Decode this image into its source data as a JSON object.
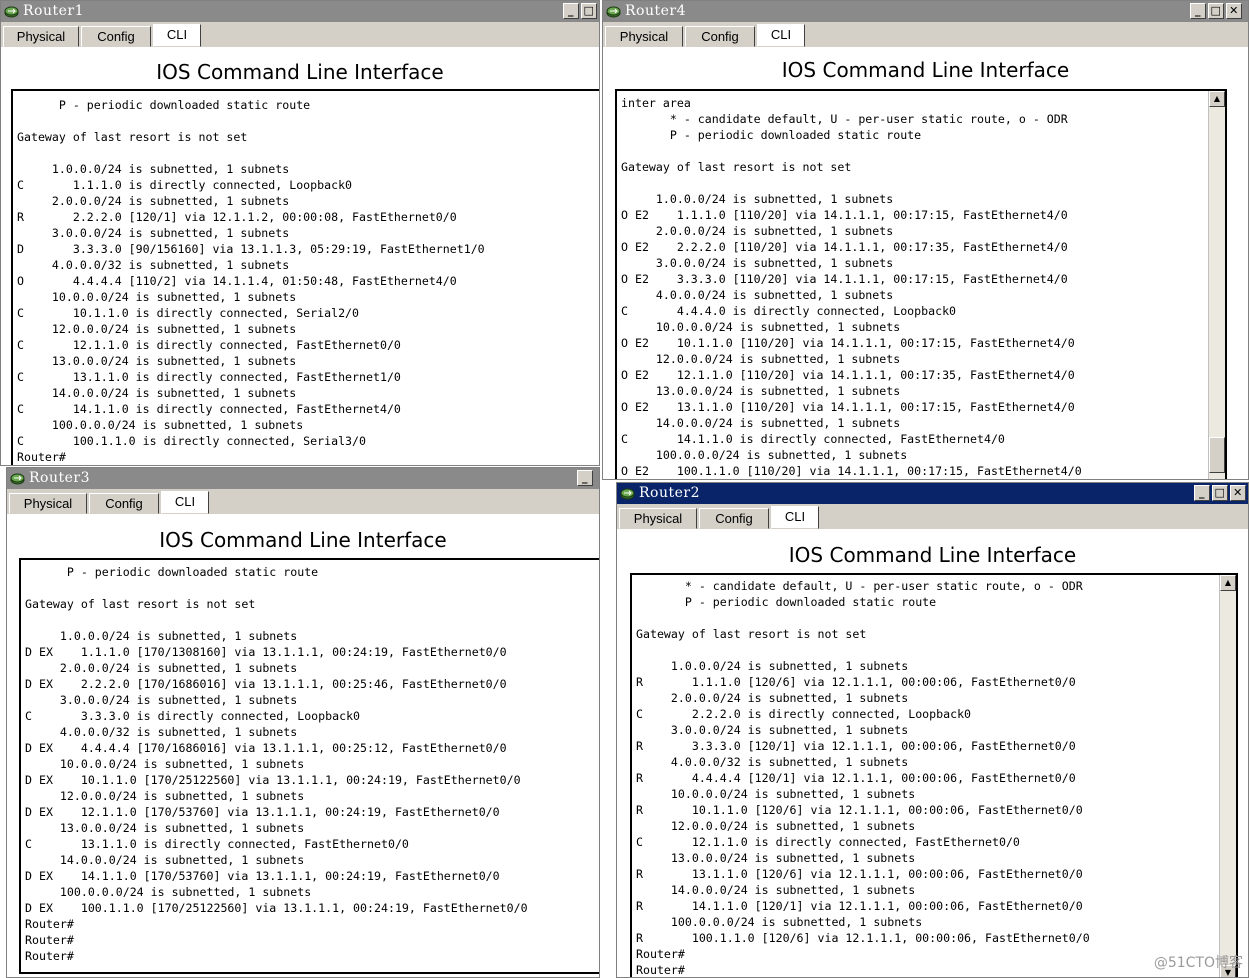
{
  "tabs": [
    "Physical",
    "Config",
    "CLI"
  ],
  "cli_title": "IOS Command Line Interface",
  "windows": {
    "r1": {
      "title": "Router1",
      "lines": [
        "      P - periodic downloaded static route",
        "",
        "Gateway of last resort is not set",
        "",
        "     1.0.0.0/24 is subnetted, 1 subnets",
        "C       1.1.1.0 is directly connected, Loopback0",
        "     2.0.0.0/24 is subnetted, 1 subnets",
        "R       2.2.2.0 [120/1] via 12.1.1.2, 00:00:08, FastEthernet0/0",
        "     3.0.0.0/24 is subnetted, 1 subnets",
        "D       3.3.3.0 [90/156160] via 13.1.1.3, 05:29:19, FastEthernet1/0",
        "     4.0.0.0/32 is subnetted, 1 subnets",
        "O       4.4.4.4 [110/2] via 14.1.1.4, 01:50:48, FastEthernet4/0",
        "     10.0.0.0/24 is subnetted, 1 subnets",
        "C       10.1.1.0 is directly connected, Serial2/0",
        "     12.0.0.0/24 is subnetted, 1 subnets",
        "C       12.1.1.0 is directly connected, FastEthernet0/0",
        "     13.0.0.0/24 is subnetted, 1 subnets",
        "C       13.1.1.0 is directly connected, FastEthernet1/0",
        "     14.0.0.0/24 is subnetted, 1 subnets",
        "C       14.1.1.0 is directly connected, FastEthernet4/0",
        "     100.0.0.0/24 is subnetted, 1 subnets",
        "C       100.1.1.0 is directly connected, Serial3/0",
        "Router#"
      ]
    },
    "r4": {
      "title": "Router4",
      "lines": [
        "inter area",
        "       * - candidate default, U - per-user static route, o - ODR",
        "       P - periodic downloaded static route",
        "",
        "Gateway of last resort is not set",
        "",
        "     1.0.0.0/24 is subnetted, 1 subnets",
        "O E2    1.1.1.0 [110/20] via 14.1.1.1, 00:17:15, FastEthernet4/0",
        "     2.0.0.0/24 is subnetted, 1 subnets",
        "O E2    2.2.2.0 [110/20] via 14.1.1.1, 00:17:35, FastEthernet4/0",
        "     3.0.0.0/24 is subnetted, 1 subnets",
        "O E2    3.3.3.0 [110/20] via 14.1.1.1, 00:17:15, FastEthernet4/0",
        "     4.0.0.0/24 is subnetted, 1 subnets",
        "C       4.4.4.0 is directly connected, Loopback0",
        "     10.0.0.0/24 is subnetted, 1 subnets",
        "O E2    10.1.1.0 [110/20] via 14.1.1.1, 00:17:15, FastEthernet4/0",
        "     12.0.0.0/24 is subnetted, 1 subnets",
        "O E2    12.1.1.0 [110/20] via 14.1.1.1, 00:17:35, FastEthernet4/0",
        "     13.0.0.0/24 is subnetted, 1 subnets",
        "O E2    13.1.1.0 [110/20] via 14.1.1.1, 00:17:15, FastEthernet4/0",
        "     14.0.0.0/24 is subnetted, 1 subnets",
        "C       14.1.1.0 is directly connected, FastEthernet4/0",
        "     100.0.0.0/24 is subnetted, 1 subnets",
        "O E2    100.1.1.0 [110/20] via 14.1.1.1, 00:17:15, FastEthernet4/0"
      ]
    },
    "r3": {
      "title": "Router3",
      "lines": [
        "      P - periodic downloaded static route",
        "",
        "Gateway of last resort is not set",
        "",
        "     1.0.0.0/24 is subnetted, 1 subnets",
        "D EX    1.1.1.0 [170/1308160] via 13.1.1.1, 00:24:19, FastEthernet0/0",
        "     2.0.0.0/24 is subnetted, 1 subnets",
        "D EX    2.2.2.0 [170/1686016] via 13.1.1.1, 00:25:46, FastEthernet0/0",
        "     3.0.0.0/24 is subnetted, 1 subnets",
        "C       3.3.3.0 is directly connected, Loopback0",
        "     4.0.0.0/32 is subnetted, 1 subnets",
        "D EX    4.4.4.4 [170/1686016] via 13.1.1.1, 00:25:12, FastEthernet0/0",
        "     10.0.0.0/24 is subnetted, 1 subnets",
        "D EX    10.1.1.0 [170/25122560] via 13.1.1.1, 00:24:19, FastEthernet0/0",
        "     12.0.0.0/24 is subnetted, 1 subnets",
        "D EX    12.1.1.0 [170/53760] via 13.1.1.1, 00:24:19, FastEthernet0/0",
        "     13.0.0.0/24 is subnetted, 1 subnets",
        "C       13.1.1.0 is directly connected, FastEthernet0/0",
        "     14.0.0.0/24 is subnetted, 1 subnets",
        "D EX    14.1.1.0 [170/53760] via 13.1.1.1, 00:24:19, FastEthernet0/0",
        "     100.0.0.0/24 is subnetted, 1 subnets",
        "D EX    100.1.1.0 [170/25122560] via 13.1.1.1, 00:24:19, FastEthernet0/0",
        "Router#",
        "Router#",
        "Router#"
      ]
    },
    "r2": {
      "title": "Router2",
      "lines": [
        "       * - candidate default, U - per-user static route, o - ODR",
        "       P - periodic downloaded static route",
        "",
        "Gateway of last resort is not set",
        "",
        "     1.0.0.0/24 is subnetted, 1 subnets",
        "R       1.1.1.0 [120/6] via 12.1.1.1, 00:00:06, FastEthernet0/0",
        "     2.0.0.0/24 is subnetted, 1 subnets",
        "C       2.2.2.0 is directly connected, Loopback0",
        "     3.0.0.0/24 is subnetted, 1 subnets",
        "R       3.3.3.0 [120/1] via 12.1.1.1, 00:00:06, FastEthernet0/0",
        "     4.0.0.0/32 is subnetted, 1 subnets",
        "R       4.4.4.4 [120/1] via 12.1.1.1, 00:00:06, FastEthernet0/0",
        "     10.0.0.0/24 is subnetted, 1 subnets",
        "R       10.1.1.0 [120/6] via 12.1.1.1, 00:00:06, FastEthernet0/0",
        "     12.0.0.0/24 is subnetted, 1 subnets",
        "C       12.1.1.0 is directly connected, FastEthernet0/0",
        "     13.0.0.0/24 is subnetted, 1 subnets",
        "R       13.1.1.0 [120/6] via 12.1.1.1, 00:00:06, FastEthernet0/0",
        "     14.0.0.0/24 is subnetted, 1 subnets",
        "R       14.1.1.0 [120/1] via 12.1.1.1, 00:00:06, FastEthernet0/0",
        "     100.0.0.0/24 is subnetted, 1 subnets",
        "R       100.1.1.0 [120/6] via 12.1.1.1, 00:00:06, FastEthernet0/0",
        "Router#",
        "Router#"
      ]
    }
  },
  "controls": {
    "minimize": "_",
    "maximize": "□",
    "close": "✕"
  },
  "scroll": {
    "up": "▲",
    "down": "▼"
  },
  "icons": {
    "window": "router-icon"
  },
  "watermark": "@51CTO博客",
  "colors": {
    "title_inactive": "#8a8a8a",
    "title_active": "#0a246a",
    "chrome": "#d4d0c8"
  }
}
